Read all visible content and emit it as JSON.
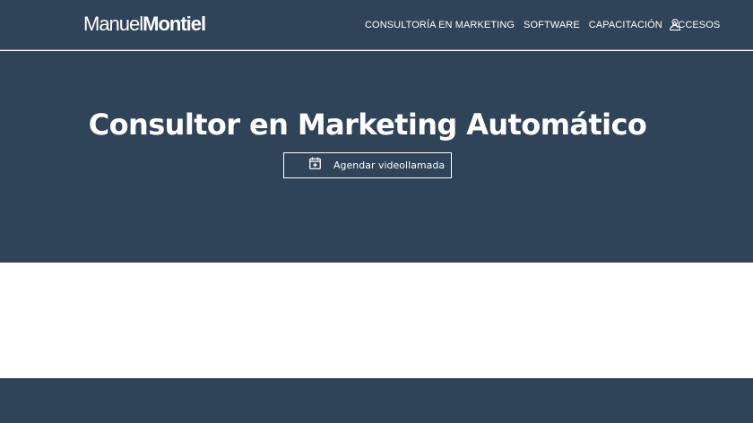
{
  "logo": {
    "part1": "Manuel",
    "part2": "Montiel"
  },
  "nav": {
    "items": [
      {
        "label": "CONSULTORÍA EN MARKETING"
      },
      {
        "label": "SOFTWARE"
      },
      {
        "label": "CAPACITACIÓN"
      },
      {
        "label": "ACCESOS"
      }
    ],
    "account_icon": "user-icon"
  },
  "hero": {
    "title": "Consultor en Marketing Automático",
    "cta_label": "Agendar videollamada",
    "cta_icon": "calendar-plus-icon"
  },
  "colors": {
    "primary_bg": "#2f4459",
    "header_border": "#c0705a",
    "text": "#ffffff"
  }
}
